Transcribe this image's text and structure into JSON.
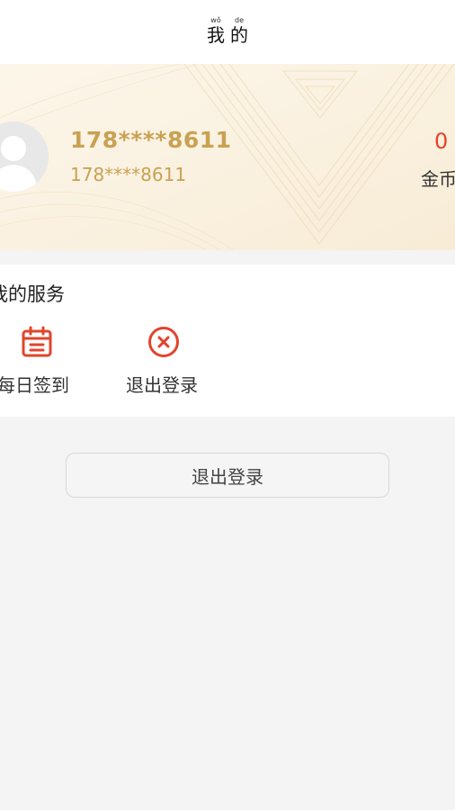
{
  "header": {
    "title_chars": [
      {
        "pinyin": "wǒ",
        "hanzi": "我"
      },
      {
        "pinyin": "de",
        "hanzi": "的"
      }
    ]
  },
  "profile": {
    "username": "178****8611",
    "account": "178****8611",
    "coins_value": "0",
    "coins_label": "金币"
  },
  "services": {
    "title": "我的服务",
    "items": [
      {
        "label": "每日签到",
        "icon": "calendar-icon"
      },
      {
        "label": "退出登录",
        "icon": "close-circle-icon"
      }
    ]
  },
  "logout_button": {
    "label": "退出登录"
  },
  "colors": {
    "accent_red": "#e2442c",
    "gold_text": "#c9a152",
    "card_bg": "#fbf3e4",
    "page_bg": "#f4f4f4"
  }
}
